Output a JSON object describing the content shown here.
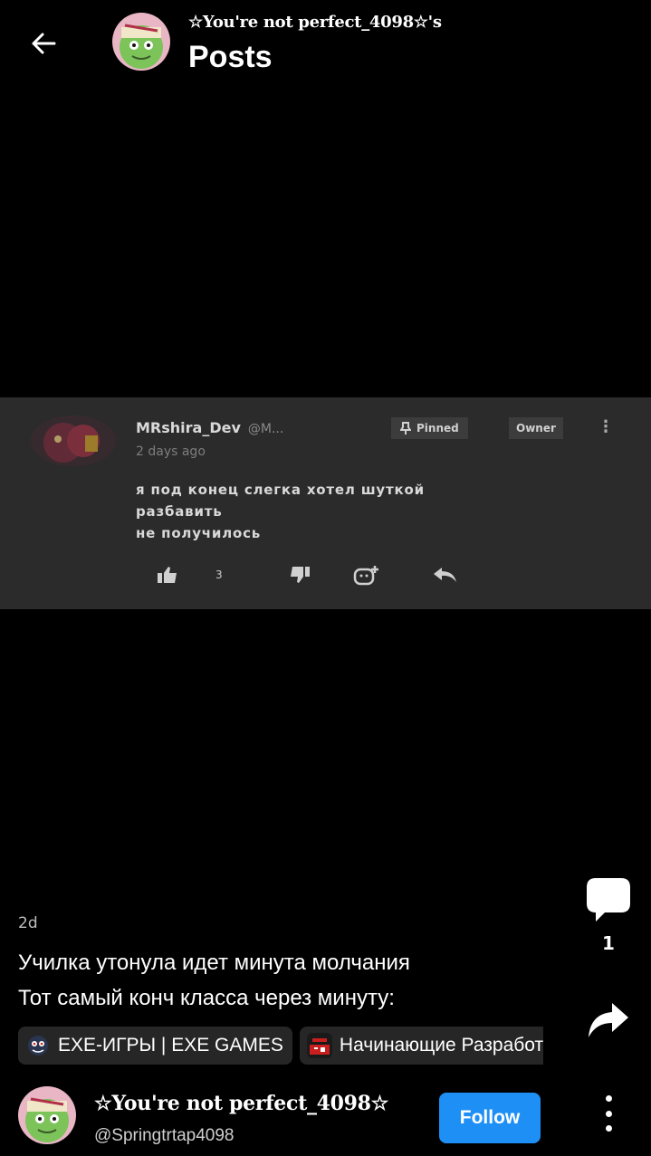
{
  "header": {
    "owner_label": "☆You're not perfect_4098☆'s",
    "title": "Posts"
  },
  "comment_shot": {
    "username": "MRshira_Dev",
    "handle": "@M...",
    "pinned_label": "Pinned",
    "owner_label": "Owner",
    "time": "2 days ago",
    "text": "я под конец слегка хотел шуткой\nразбавить\nне получилось",
    "like_count": "3"
  },
  "rail": {
    "comment_count": "1"
  },
  "post": {
    "time": "2d",
    "caption_line1": "Училка утонула идет минута молчания",
    "caption_line2": "Тот самый конч класса через минуту:",
    "tags": [
      {
        "label": "EXE-ИГРЫ | EXE GAMES"
      },
      {
        "label": "Начинающие Разработчики"
      }
    ]
  },
  "author": {
    "name": "☆You're not perfect_4098☆",
    "handle": "@Springtrtap4098",
    "follow_label": "Follow"
  },
  "colors": {
    "background": "#000000",
    "follow_button": "#1e90f5",
    "comment_bg": "#2b2b2b"
  }
}
